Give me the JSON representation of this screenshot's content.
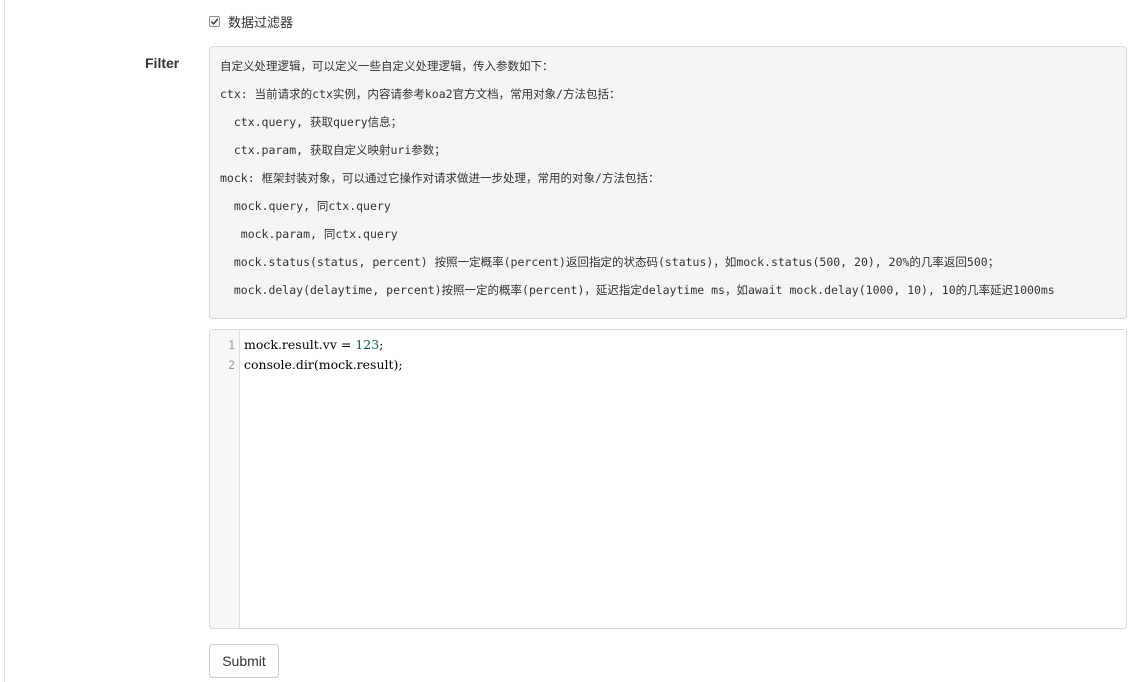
{
  "form": {
    "checkbox_label": "数据过滤器",
    "checkbox_checked": true,
    "filter_label": "Filter",
    "help_lines": [
      "自定义处理逻辑，可以定义一些自定义处理逻辑，传入参数如下：",
      "ctx: 当前请求的ctx实例，内容请参考koa2官方文档，常用对象/方法包括：",
      "  ctx.query, 获取query信息；",
      "  ctx.param, 获取自定义映射uri参数；",
      "mock: 框架封装对象，可以通过它操作对请求做进一步处理，常用的对象/方法包括：",
      "  mock.query, 同ctx.query",
      "   mock.param, 同ctx.query",
      "  mock.status(status, percent) 按照一定概率(percent)返回指定的状态码(status)，如mock.status(500, 20), 20%的几率返回500；",
      "  mock.delay(delaytime, percent)按照一定的概率(percent)，延迟指定delaytime ms，如await mock.delay(1000, 10), 10的几率延迟1000ms"
    ],
    "code": {
      "line_numbers": [
        "1",
        "2"
      ],
      "line1_prefix": "mock.result.vv = ",
      "line1_number": "123",
      "line1_suffix": ";",
      "line2": "console.dir(mock.result);"
    },
    "submit_label": "Submit"
  },
  "colors": {
    "number_token": "#116644",
    "help_background": "#f5f5f5"
  }
}
